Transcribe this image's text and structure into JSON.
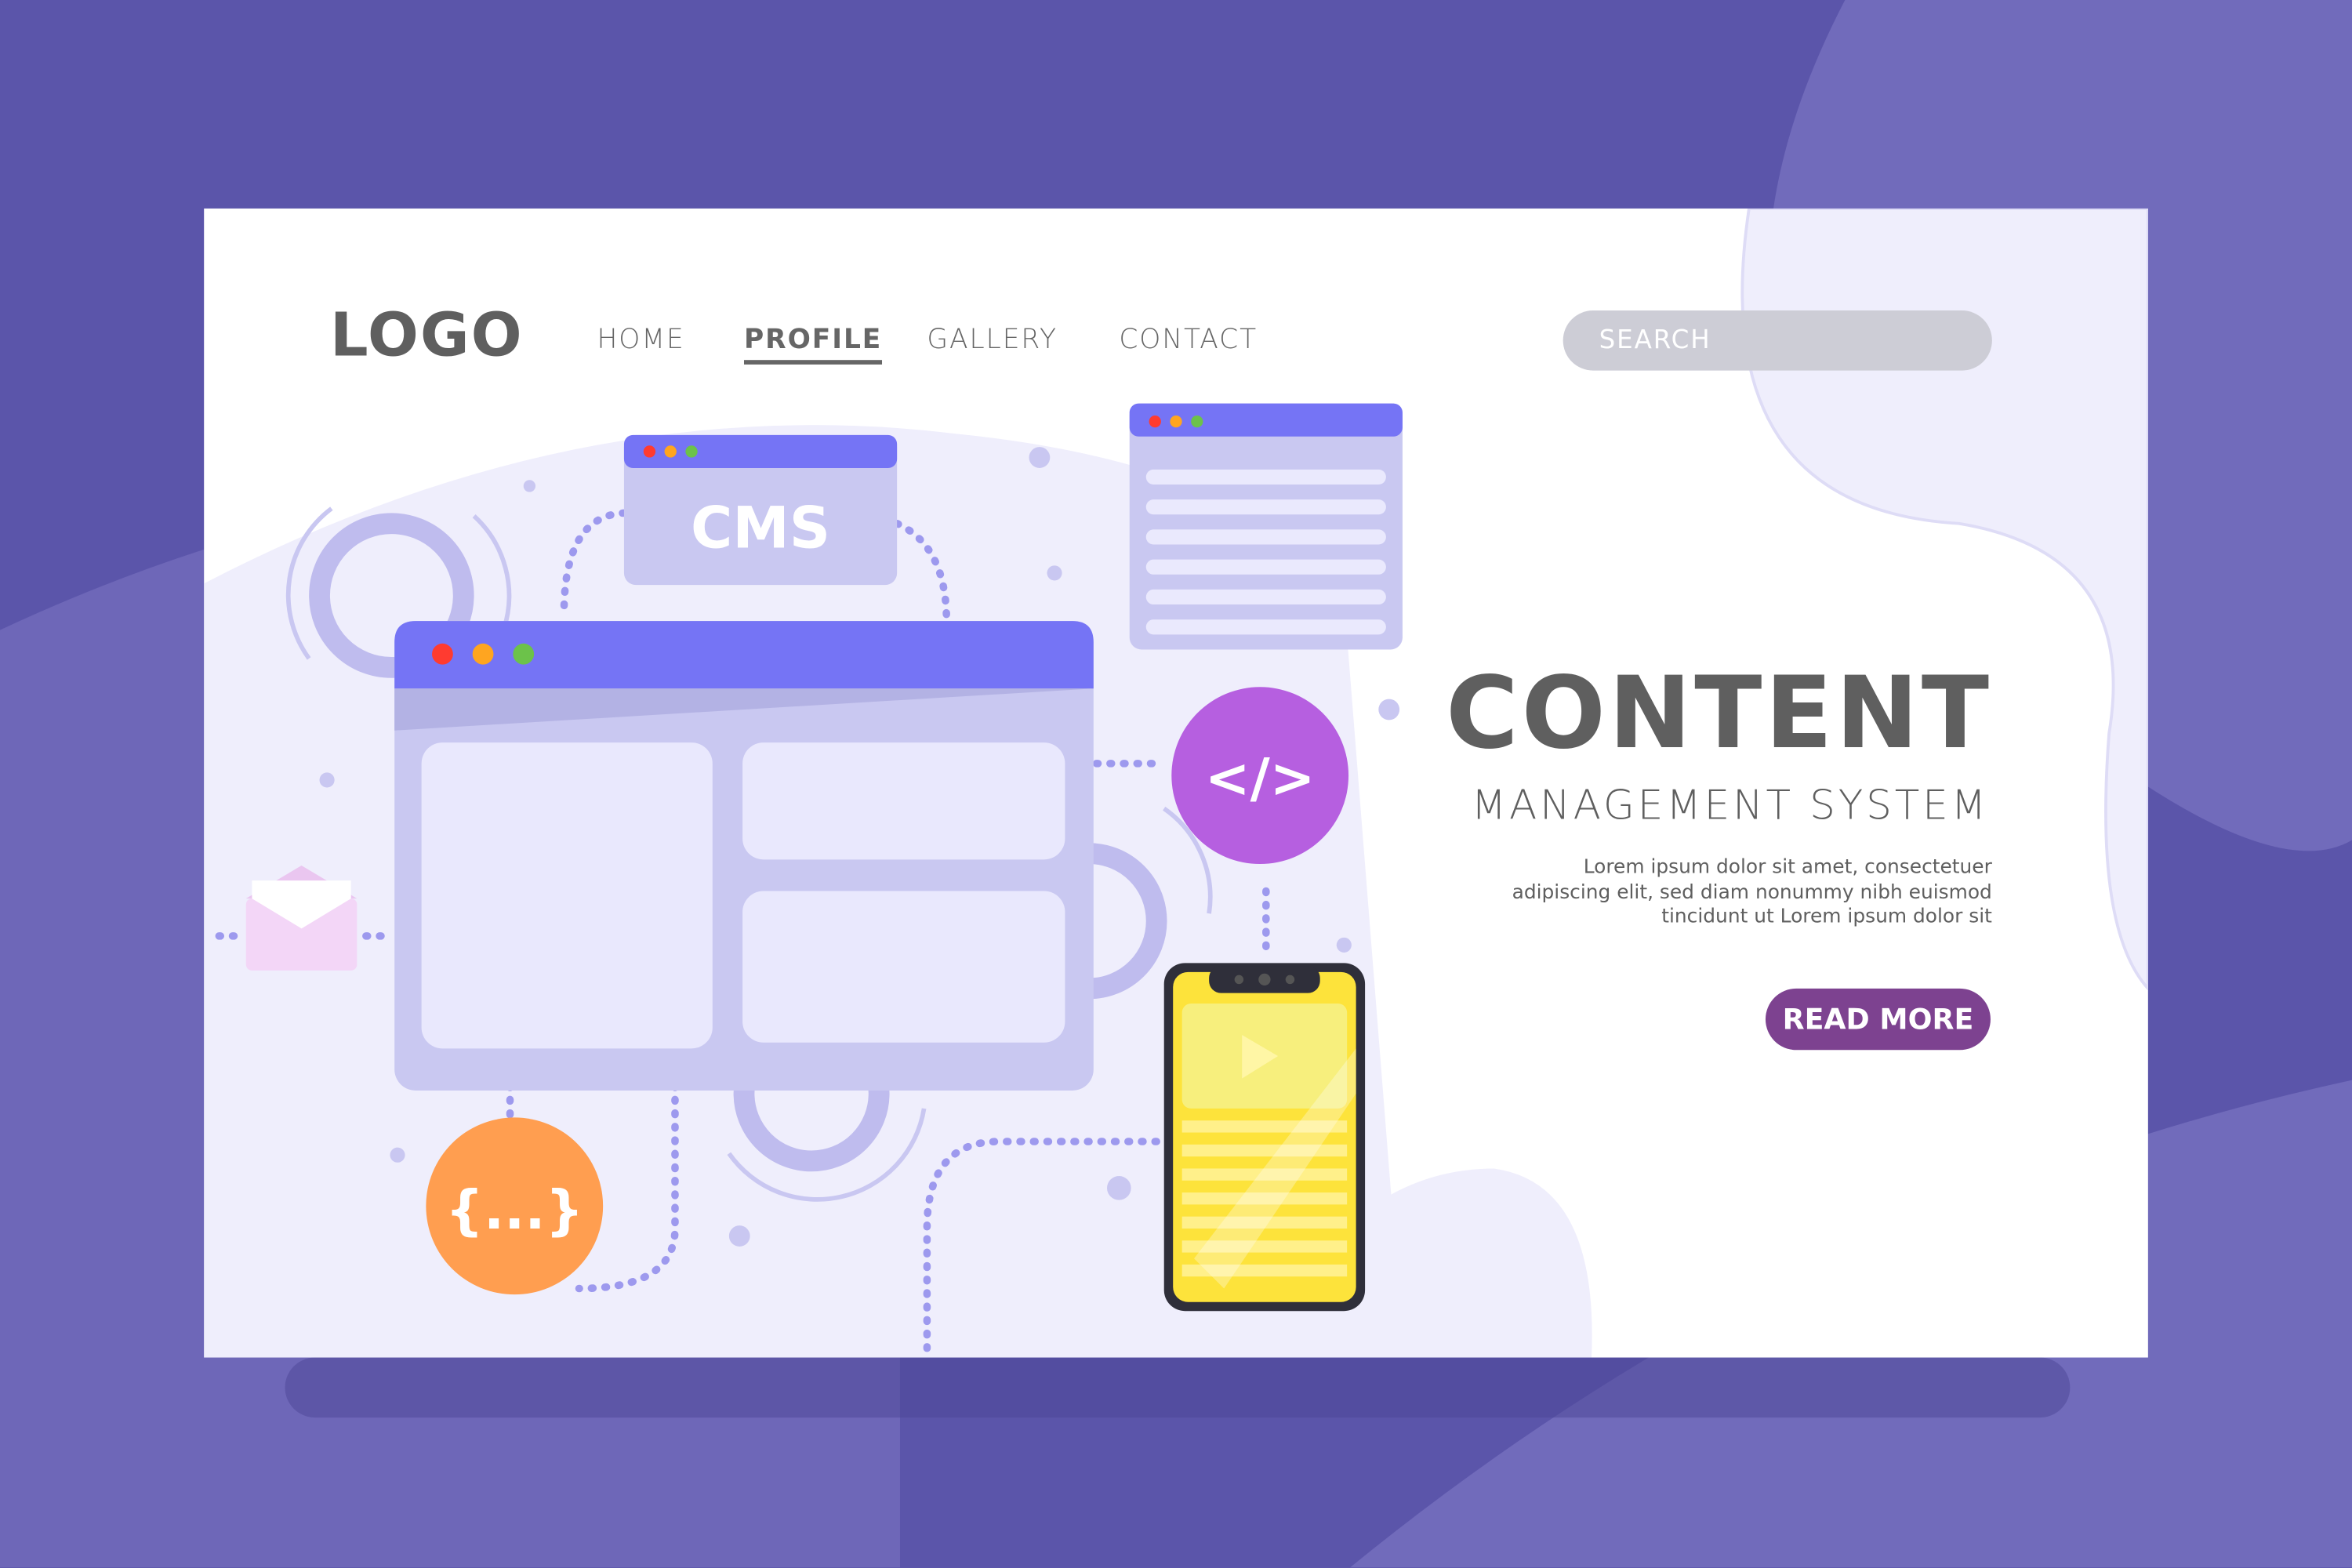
{
  "header": {
    "logo": "LOGO",
    "nav": [
      {
        "label": "HOME"
      },
      {
        "label": "PROFILE",
        "active": true
      },
      {
        "label": "GALLERY"
      },
      {
        "label": "CONTACT"
      }
    ],
    "search_placeholder": "SEARCH"
  },
  "hero": {
    "title": "CONTENT",
    "subtitle": "MANAGEMENT SYSTEM",
    "body": "Lorem ipsum dolor sit amet, consectetuer adipiscing elit, sed diam nonummy nibh euismod tincidunt ut Lorem ipsum dolor sit",
    "cta": "READ MORE"
  },
  "illustration": {
    "cms_label": "CMS",
    "code_label": "</>",
    "json_label": "{...}"
  },
  "colors": {
    "background": "#5b55aa",
    "accent": "#7d4290",
    "window_header": "#7574f5",
    "window_body": "#c9c8f1",
    "code_circle": "#b65fe0",
    "json_circle": "#ff9e50",
    "phone": "#fde33b"
  }
}
